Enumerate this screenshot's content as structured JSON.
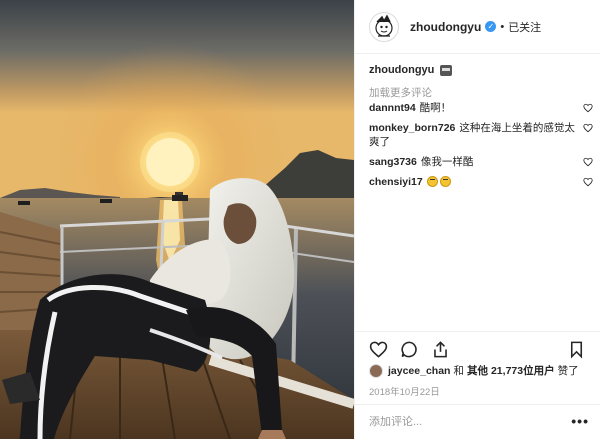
{
  "photo": {
    "alt_icon": "sunset-boat-photo"
  },
  "header": {
    "username": "zhoudongyu",
    "verified_icon": "verified-badge-icon",
    "verified_glyph": "✓",
    "separator": "•",
    "follow_status": "已关注",
    "avatar_icon": "cartoon-avatar-icon"
  },
  "caption": {
    "username": "zhoudongyu",
    "emoji_icon": "emoji-icon"
  },
  "load_more": "加载更多评论",
  "comments": [
    {
      "user": "dannnt94",
      "text": "酷啊！"
    },
    {
      "user": "monkey_born726",
      "text": "这种在海上坐着的感觉太爽了"
    },
    {
      "user": "sang3736",
      "text": "像我一样酷"
    },
    {
      "user": "chensiyi17",
      "text": ""
    }
  ],
  "actions": {
    "like_icon": "heart-icon",
    "comment_icon": "comment-icon",
    "share_icon": "share-icon",
    "save_icon": "bookmark-icon"
  },
  "likes": {
    "first_user": "jaycee_chan",
    "connector": "和",
    "others_label": "其他",
    "count": "21,773",
    "users_suffix": "位用户",
    "liked_label": "赞了"
  },
  "timestamp": "2018年10月22日",
  "add_comment": {
    "placeholder": "添加评论...",
    "more_label": "•••"
  },
  "colors": {
    "accent_blue": "#3897f0",
    "text_primary": "#262626",
    "text_muted": "#999999",
    "border": "#efefef"
  }
}
